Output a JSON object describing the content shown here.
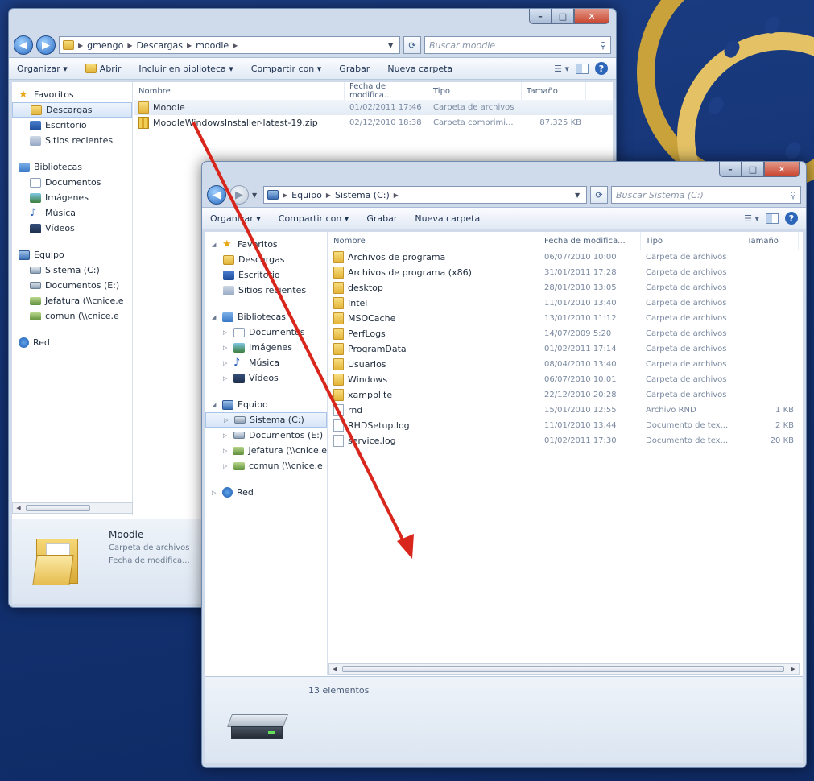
{
  "colors": {
    "desktop": "#143374",
    "arrow": "#d8261c",
    "selection": "#d6e5f8"
  },
  "back_window": {
    "address": {
      "crumbs": [
        "gmengo",
        "Descargas",
        "moodle"
      ]
    },
    "search_placeholder": "Buscar moodle",
    "toolbar": {
      "organize": "Organizar ▾",
      "open": "Abrir",
      "include": "Incluir en biblioteca ▾",
      "share": "Compartir con ▾",
      "burn": "Grabar",
      "new_folder": "Nueva carpeta"
    },
    "nav": {
      "favorites": "Favoritos",
      "downloads": "Descargas",
      "desktop": "Escritorio",
      "recent": "Sitios recientes",
      "libraries": "Bibliotecas",
      "documents": "Documentos",
      "pictures": "Imágenes",
      "music": "Música",
      "videos": "Vídeos",
      "computer": "Equipo",
      "system": "Sistema (C:)",
      "docs_drive": "Documentos (E:)",
      "jefatura": "Jefatura (\\\\cnice.e",
      "comun": "comun (\\\\cnice.e",
      "network": "Red"
    },
    "columns": {
      "name": "Nombre",
      "date": "Fecha de modifica...",
      "type": "Tipo",
      "size": "Tamaño"
    },
    "files": [
      {
        "name": "Moodle",
        "date": "01/02/2011 17:46",
        "type": "Carpeta de archivos",
        "size": "",
        "icon": "folder-icon"
      },
      {
        "name": "MoodleWindowsInstaller-latest-19.zip",
        "date": "02/12/2010 18:38",
        "type": "Carpeta comprimi...",
        "size": "87.325 KB",
        "icon": "zip-icon"
      }
    ],
    "details": {
      "name": "Moodle",
      "type": "Carpeta de archivos",
      "date": "Fecha de modifica..."
    }
  },
  "front_window": {
    "address": {
      "crumbs": [
        "Equipo",
        "Sistema (C:)"
      ]
    },
    "search_placeholder": "Buscar Sistema (C:)",
    "toolbar": {
      "organize": "Organizar ▾",
      "share": "Compartir con ▾",
      "burn": "Grabar",
      "new_folder": "Nueva carpeta"
    },
    "nav": {
      "favorites": "Favoritos",
      "downloads": "Descargas",
      "desktop": "Escritorio",
      "recent": "Sitios recientes",
      "libraries": "Bibliotecas",
      "documents": "Documentos",
      "pictures": "Imágenes",
      "music": "Música",
      "videos": "Vídeos",
      "computer": "Equipo",
      "system": "Sistema (C:)",
      "docs_drive": "Documentos (E:)",
      "jefatura": "Jefatura (\\\\cnice.e",
      "comun": "comun (\\\\cnice.e",
      "network": "Red"
    },
    "columns": {
      "name": "Nombre",
      "date": "Fecha de modifica...",
      "type": "Tipo",
      "size": "Tamaño"
    },
    "files": [
      {
        "name": "Archivos de programa",
        "date": "06/07/2010 10:00",
        "type": "Carpeta de archivos",
        "size": "",
        "icon": "folder-icon"
      },
      {
        "name": "Archivos de programa (x86)",
        "date": "31/01/2011 17:28",
        "type": "Carpeta de archivos",
        "size": "",
        "icon": "folder-icon"
      },
      {
        "name": "desktop",
        "date": "28/01/2010 13:05",
        "type": "Carpeta de archivos",
        "size": "",
        "icon": "folder-icon"
      },
      {
        "name": "Intel",
        "date": "11/01/2010 13:40",
        "type": "Carpeta de archivos",
        "size": "",
        "icon": "folder-icon"
      },
      {
        "name": "MSOCache",
        "date": "13/01/2010 11:12",
        "type": "Carpeta de archivos",
        "size": "",
        "icon": "folder-icon"
      },
      {
        "name": "PerfLogs",
        "date": "14/07/2009 5:20",
        "type": "Carpeta de archivos",
        "size": "",
        "icon": "folder-icon"
      },
      {
        "name": "ProgramData",
        "date": "01/02/2011 17:14",
        "type": "Carpeta de archivos",
        "size": "",
        "icon": "folder-icon"
      },
      {
        "name": "Usuarios",
        "date": "08/04/2010 13:40",
        "type": "Carpeta de archivos",
        "size": "",
        "icon": "folder-icon"
      },
      {
        "name": "Windows",
        "date": "06/07/2010 10:01",
        "type": "Carpeta de archivos",
        "size": "",
        "icon": "folder-icon"
      },
      {
        "name": "xampplite",
        "date": "22/12/2010 20:28",
        "type": "Carpeta de archivos",
        "size": "",
        "icon": "folder-icon"
      },
      {
        "name": "rnd",
        "date": "15/01/2010 12:55",
        "type": "Archivo RND",
        "size": "1 KB",
        "icon": "file-icon"
      },
      {
        "name": "RHDSetup.log",
        "date": "11/01/2010 13:44",
        "type": "Documento de tex...",
        "size": "2 KB",
        "icon": "file-icon"
      },
      {
        "name": "service.log",
        "date": "01/02/2011 17:30",
        "type": "Documento de tex...",
        "size": "20 KB",
        "icon": "file-icon"
      }
    ],
    "status": "13 elementos"
  }
}
